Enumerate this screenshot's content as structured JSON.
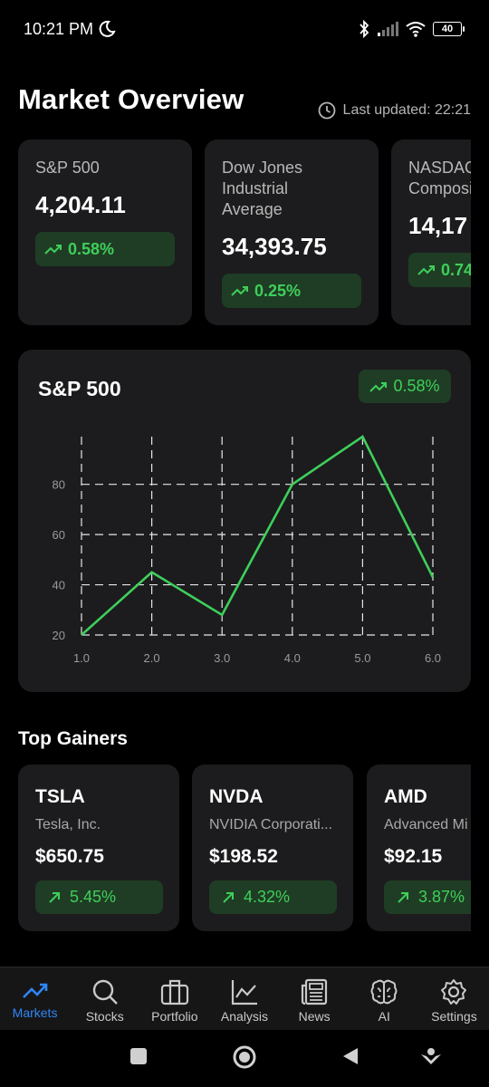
{
  "status": {
    "time": "10:21 PM",
    "battery": "40"
  },
  "header": {
    "title": "Market Overview",
    "last_updated": "Last updated: 22:21"
  },
  "indices": [
    {
      "name": "S&P 500",
      "value": "4,204.11",
      "change": "0.58%"
    },
    {
      "name": "Dow Jones Industrial Average",
      "value": "34,393.75",
      "change": "0.25%"
    },
    {
      "name": "NASDAQ Composite",
      "value": "14,17",
      "change": "0.74"
    }
  ],
  "chart_card": {
    "title": "S&P 500",
    "change": "0.58%"
  },
  "chart_data": {
    "type": "line",
    "x": [
      1.0,
      2.0,
      3.0,
      4.0,
      5.0,
      6.0
    ],
    "series": [
      {
        "values": [
          20,
          45,
          28,
          80,
          99,
          43
        ],
        "color": "#3ecf5b"
      }
    ],
    "xticks": [
      "1.0",
      "2.0",
      "3.0",
      "4.0",
      "5.0",
      "6.0"
    ],
    "yticks": [
      "20",
      "40",
      "60",
      "80"
    ],
    "xlim": [
      1.0,
      6.0
    ],
    "ylim": [
      20,
      99
    ],
    "grid": true
  },
  "gainers_section": {
    "title": "Top Gainers"
  },
  "gainers": [
    {
      "ticker": "TSLA",
      "company": "Tesla, Inc.",
      "price": "$650.75",
      "change": "5.45%"
    },
    {
      "ticker": "NVDA",
      "company": "NVIDIA Corporati...",
      "price": "$198.52",
      "change": "4.32%"
    },
    {
      "ticker": "AMD",
      "company": "Advanced Mi",
      "price": "$92.15",
      "change": "3.87%"
    }
  ],
  "nav": [
    {
      "label": "Markets",
      "icon": "trending-up-icon",
      "active": true
    },
    {
      "label": "Stocks",
      "icon": "search-icon"
    },
    {
      "label": "Portfolio",
      "icon": "briefcase-icon"
    },
    {
      "label": "Analysis",
      "icon": "chart-line-icon"
    },
    {
      "label": "News",
      "icon": "newspaper-icon"
    },
    {
      "label": "AI",
      "icon": "brain-icon"
    },
    {
      "label": "Settings",
      "icon": "gear-icon"
    }
  ],
  "colors": {
    "accent": "#2f86f6",
    "positive": "#3ecf5b",
    "card": "#1c1c1e"
  }
}
